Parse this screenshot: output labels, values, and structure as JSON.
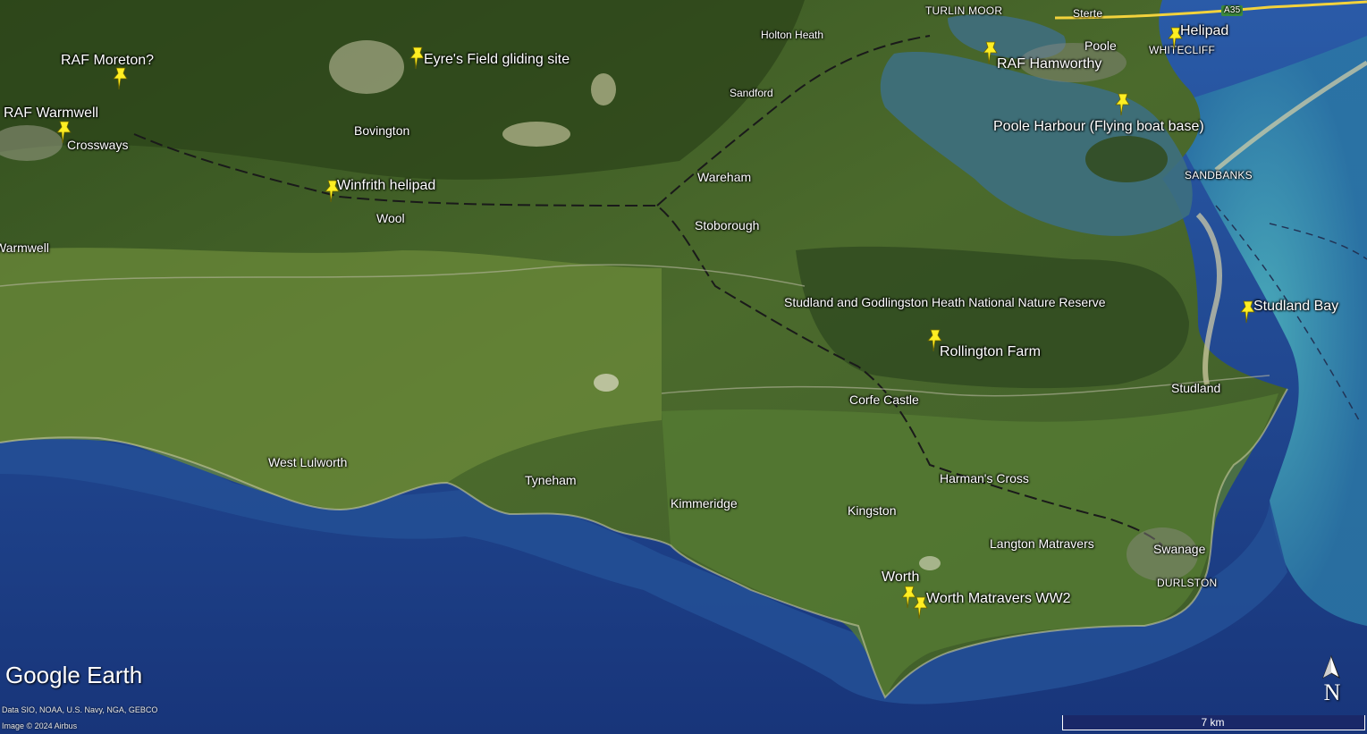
{
  "app": {
    "logo_text": "Google Earth",
    "attribution_data": "Data SIO, NOAA, U.S. Navy, NGA, GEBCO",
    "attribution_image": "Image © 2024 Airbus"
  },
  "pins": [
    {
      "label": "RAF Moreton?"
    },
    {
      "label": "Eyre's Field gliding site"
    },
    {
      "label": "RAF Warmwell"
    },
    {
      "label": "Winfrith helipad"
    },
    {
      "label": "RAF Hamworthy"
    },
    {
      "label": "Helipad"
    },
    {
      "label": "Poole Harbour (Flying boat base)"
    },
    {
      "label": "Studland Bay"
    },
    {
      "label": "Rollington Farm"
    },
    {
      "label": "Worth"
    },
    {
      "label": "Worth Matravers WW2"
    }
  ],
  "places": [
    {
      "name": "Crossways"
    },
    {
      "name": "Bovington"
    },
    {
      "name": "Wool"
    },
    {
      "name": "Warmwell"
    },
    {
      "name": "Holton Heath"
    },
    {
      "name": "Sandford"
    },
    {
      "name": "TURLIN MOOR"
    },
    {
      "name": "Sterte"
    },
    {
      "name": "Poole"
    },
    {
      "name": "WHITECLIFF"
    },
    {
      "name": "A35"
    },
    {
      "name": "Wareham"
    },
    {
      "name": "Stoborough"
    },
    {
      "name": "SANDBANKS"
    },
    {
      "name": "Studland and Godlingston Heath National Nature Reserve"
    },
    {
      "name": "Corfe Castle"
    },
    {
      "name": "Studland"
    },
    {
      "name": "West Lulworth"
    },
    {
      "name": "Tyneham"
    },
    {
      "name": "Kimmeridge"
    },
    {
      "name": "Harman's Cross"
    },
    {
      "name": "Kingston"
    },
    {
      "name": "Langton Matravers"
    },
    {
      "name": "Swanage"
    },
    {
      "name": "DURLSTON"
    }
  ],
  "controls": {
    "compass_letter": "N",
    "scale_label": "7 km"
  },
  "colors": {
    "sea_deep": "#1e4487",
    "sea_shallow": "#3aa6b5",
    "land": "#3f5a2b",
    "pin": "#ffee22"
  }
}
